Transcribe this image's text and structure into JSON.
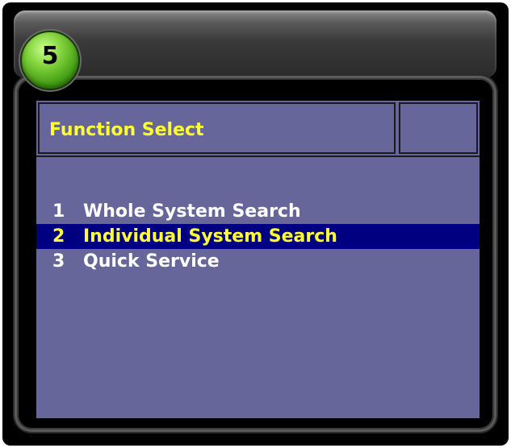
{
  "step_number": "5",
  "header": {
    "title": "Function Select",
    "side": ""
  },
  "menu": {
    "items": [
      {
        "number": "1",
        "label": "Whole System Search",
        "selected": false
      },
      {
        "number": "2",
        "label": "Individual System Search",
        "selected": true
      },
      {
        "number": "3",
        "label": "Quick Service",
        "selected": false
      }
    ]
  },
  "colors": {
    "screen_background": "#66669a",
    "selected_row": "#000080",
    "highlight_text": "#ffff33",
    "menu_text": "#ffffff",
    "badge_green": "#3f9a12"
  }
}
